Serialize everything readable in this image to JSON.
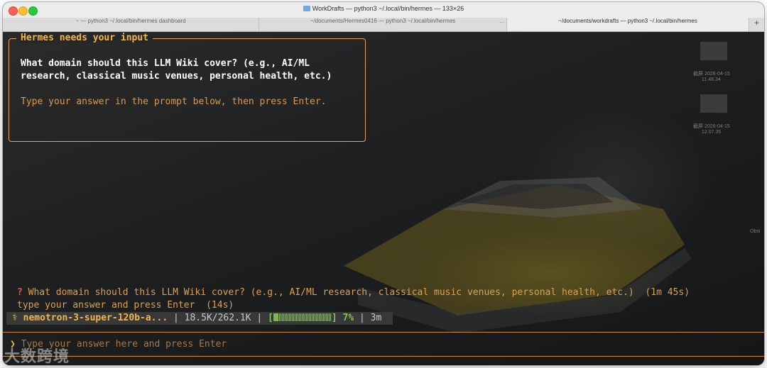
{
  "window": {
    "title": "WorkDrafts — python3 ~/.local/bin/hermes — 133×26"
  },
  "tabs": [
    {
      "label": "~ — python3 ~/.local/bin/hermes dashboard",
      "active": false
    },
    {
      "label": "~/documents/Hermes0416 — python3 ~/.local/bin/hermes",
      "active": false,
      "overflow": "..."
    },
    {
      "label": "~/documents/workdrafts — python3 ~/.local/bin/hermes",
      "active": true
    }
  ],
  "new_tab_label": "+",
  "prompt_box": {
    "title": "Hermes needs your input",
    "question_line1": "What domain should this LLM Wiki cover? (e.g., AI/ML",
    "question_line2": "research, classical music venues, personal health, etc.)",
    "hint": "Type your answer in the prompt below, then press Enter."
  },
  "status": {
    "question_mark": "?",
    "question_text": "What domain should this LLM Wiki cover? (e.g., AI/ML research, classical music venues, personal health, etc.)  (1m 45s)",
    "hint_text": "type your answer and press Enter  (14s)"
  },
  "status_bar": {
    "icon": "⚕",
    "model": "nemotron-3-super-120b-a...",
    "sep1": " | ",
    "tokens": "18.5K/262.1K",
    "sep2": " | ",
    "bracket_open": "[",
    "bracket_close": "]",
    "percent": "7%",
    "percent_value": 7,
    "sep3": " | ",
    "elapsed": "3m"
  },
  "input": {
    "prompt_symbol": "❯",
    "placeholder": "Type your answer here and press Enter"
  },
  "watermark": "大数跨境",
  "desktop_labels": [
    "截屏 2026-04-15",
    "11.48.34",
    "截屏 2026-04-15",
    "12.07.35",
    "Obsi"
  ],
  "colors": {
    "accent": "#f3b54a",
    "border": "#e8a25a",
    "progress": "#7ec850",
    "error": "#ff4d4d"
  }
}
